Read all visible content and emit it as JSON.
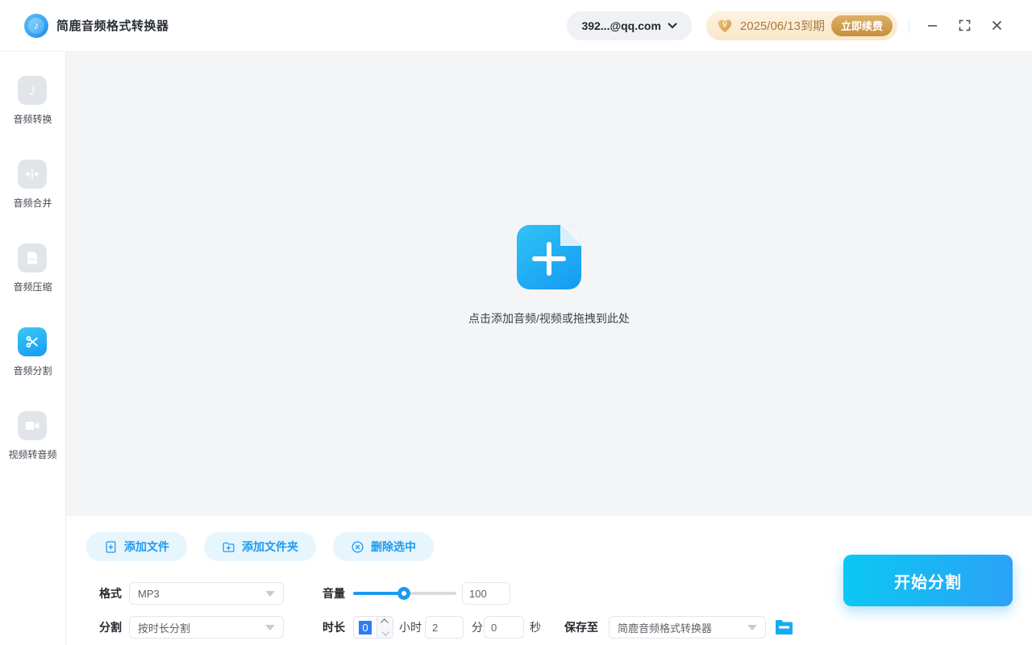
{
  "app": {
    "title": "简鹿音频格式转换器"
  },
  "titlebar": {
    "account": "392...@qq.com",
    "vip_expiry": "2025/06/13到期",
    "renew_label": "立即续费"
  },
  "sidebar": {
    "items": [
      {
        "label": "音频转换",
        "icon": "music-note-icon",
        "active": false
      },
      {
        "label": "音频合并",
        "icon": "merge-arrows-icon",
        "active": false
      },
      {
        "label": "音频压缩",
        "icon": "compress-file-icon",
        "active": false
      },
      {
        "label": "音频分割",
        "icon": "scissors-icon",
        "active": true
      },
      {
        "label": "视频转音频",
        "icon": "video-camera-icon",
        "active": false
      }
    ]
  },
  "dropzone": {
    "hint": "点击添加音频/视频或拖拽到此处"
  },
  "toolbar": {
    "add_file": "添加文件",
    "add_folder": "添加文件夹",
    "delete_selected": "删除选中"
  },
  "settings": {
    "format": {
      "label": "格式",
      "value": "MP3"
    },
    "volume": {
      "label": "音量",
      "value": "100",
      "percent": 49
    },
    "split": {
      "label": "分割",
      "value": "按时长分割"
    },
    "duration": {
      "label": "时长",
      "hours": "0",
      "hours_unit": "小时",
      "minutes": "2",
      "minutes_unit": "分",
      "seconds": "0",
      "seconds_unit": "秒"
    },
    "save": {
      "label": "保存至",
      "value": "简鹿音频格式转换器"
    }
  },
  "actions": {
    "start": "开始分割"
  },
  "colors": {
    "accent": "#1d9af0",
    "accent_cyan": "#0bc8f3",
    "vip_text": "#a97a3c",
    "selection_blue": "#2e7cf6"
  }
}
